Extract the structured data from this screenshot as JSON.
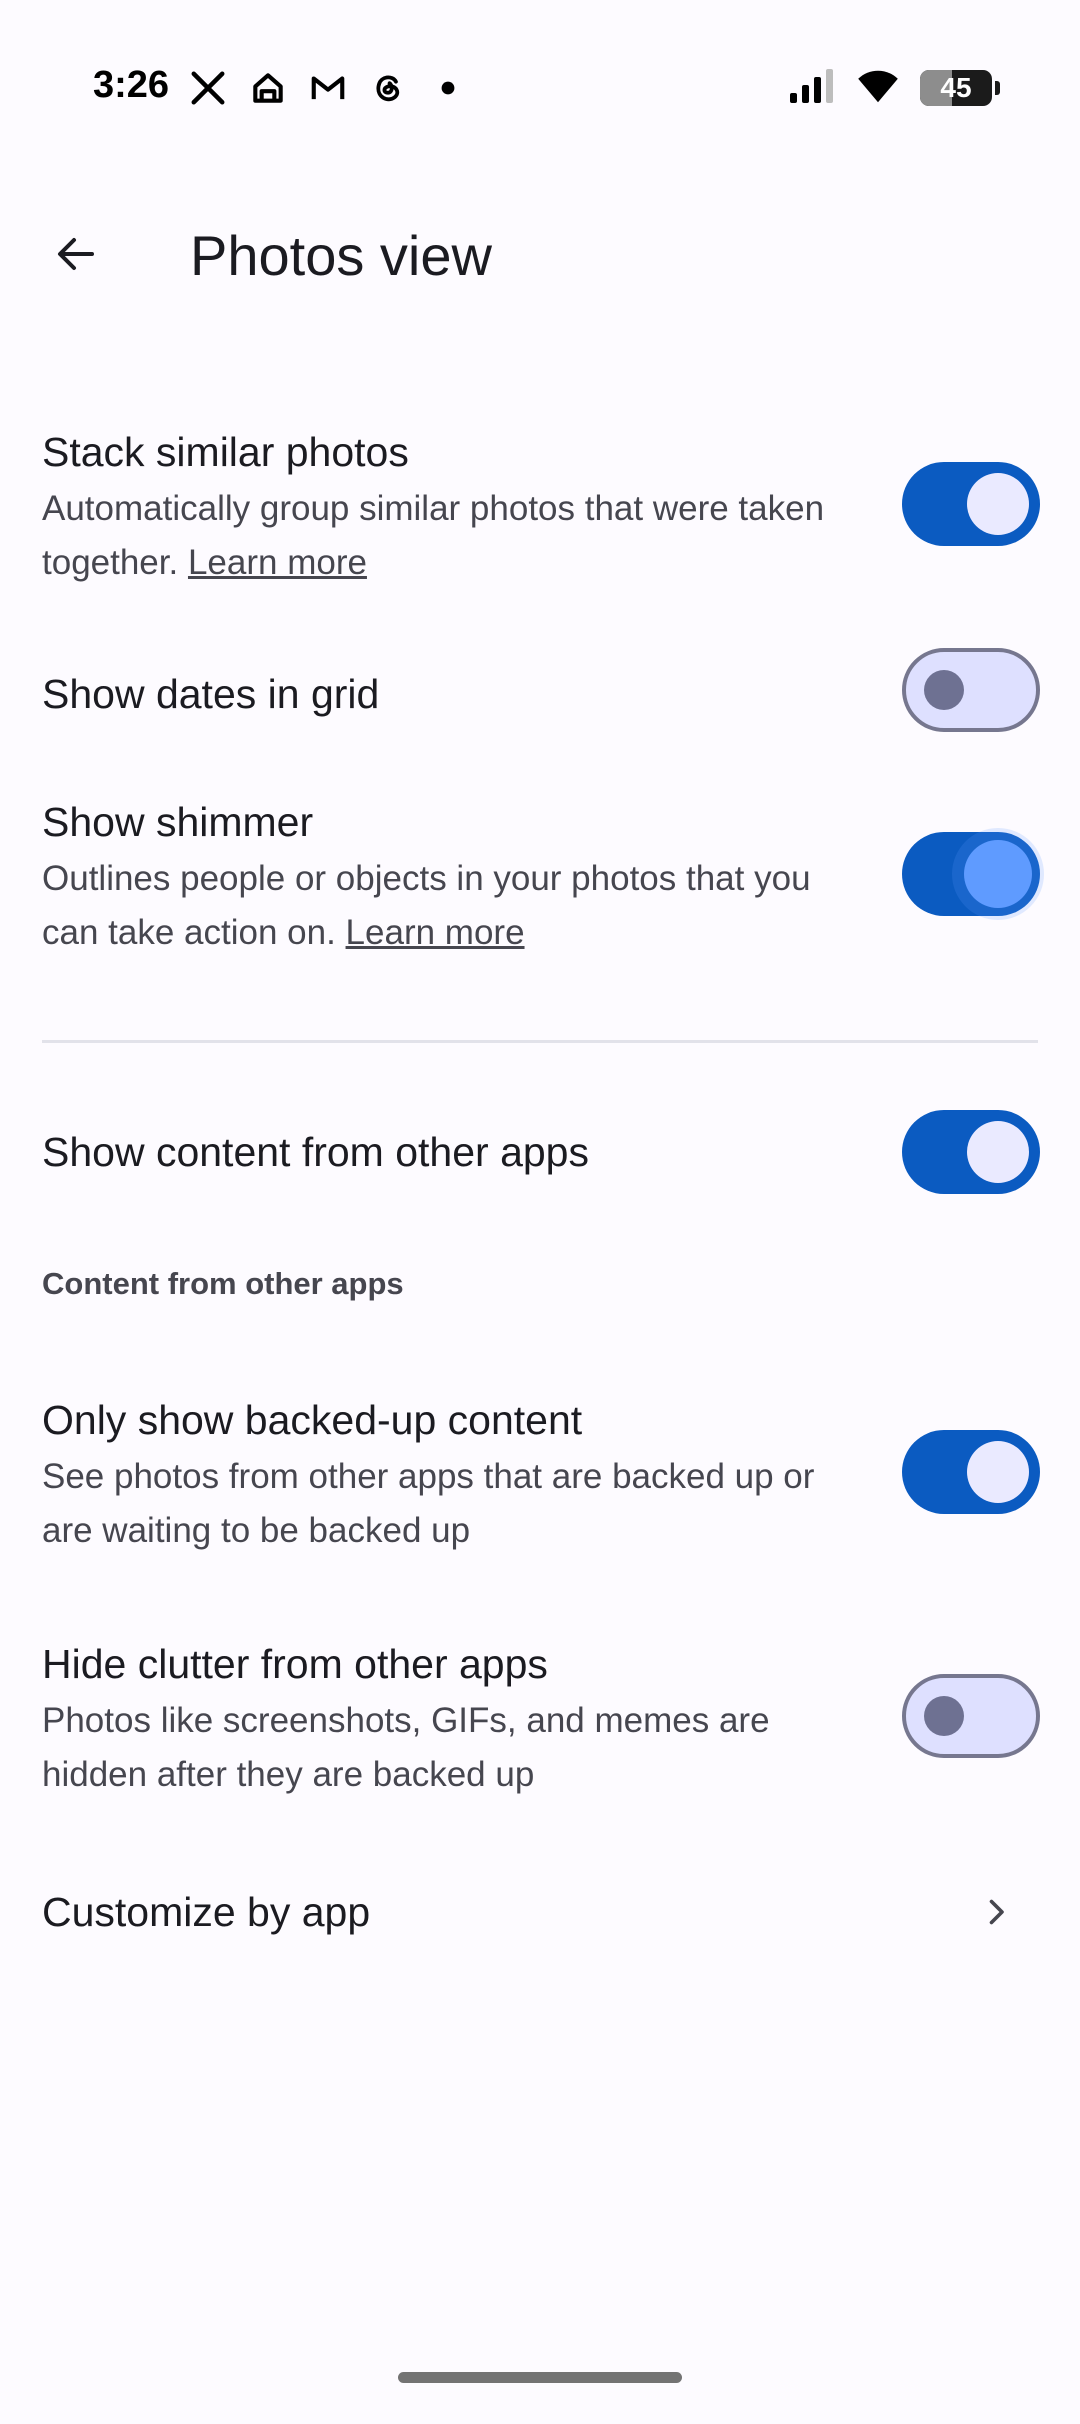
{
  "status_bar": {
    "time": "3:26",
    "notification_icons": [
      "x-icon",
      "home-icon",
      "gmail-icon",
      "threads-icon",
      "dot-icon"
    ],
    "battery_level": "45",
    "battery_fraction": 0.45
  },
  "app_bar": {
    "title": "Photos view",
    "back_icon": "arrow-back-icon"
  },
  "settings": {
    "stack_similar": {
      "title": "Stack similar photos",
      "desc": "Automatically group similar photos that were taken together.",
      "link": "Learn more",
      "enabled": true
    },
    "show_dates": {
      "title": "Show dates in grid",
      "enabled": false
    },
    "show_shimmer": {
      "title": "Show shimmer",
      "desc": "Outlines people or objects in your photos that you can take action on.",
      "link": "Learn more",
      "enabled": true
    },
    "show_content_other_apps": {
      "title": "Show content from other apps",
      "enabled": true
    },
    "section_header": "Content from other apps",
    "only_backed_up": {
      "title": "Only show backed-up content",
      "desc": "See photos from other apps that are backed up or are waiting to be backed up",
      "enabled": true
    },
    "hide_clutter": {
      "title": "Hide clutter from other apps",
      "desc": "Photos like screenshots, GIFs, and memes are hidden after they are backed up",
      "enabled": false
    },
    "customize_by_app": {
      "title": "Customize by app",
      "icon": "chevron-right-icon"
    }
  },
  "colors": {
    "accent": "#0b5bc1",
    "toggle_off_track": "#dee0ff",
    "text_primary": "#1b1b21",
    "text_secondary": "#46464f"
  }
}
